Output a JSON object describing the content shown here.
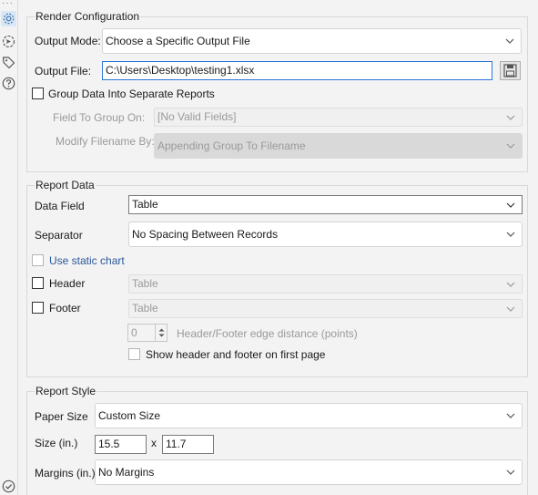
{
  "render": {
    "title": "Render Configuration",
    "output_mode_label": "Output Mode:",
    "output_mode_value": "Choose a Specific Output File",
    "output_file_label": "Output File:",
    "output_file_value": "C:\\Users\\Desktop\\testing1.xlsx",
    "group_data_label": "Group Data Into Separate Reports",
    "field_to_group_label": "Field To Group On:",
    "field_to_group_value": "[No Valid Fields]",
    "modify_filename_label": "Modify Filename By:",
    "modify_filename_value": "Appending Group To Filename"
  },
  "report_data": {
    "title": "Report Data",
    "data_field_label": "Data Field",
    "data_field_value": "Table",
    "separator_label": "Separator",
    "separator_value": "No Spacing Between Records",
    "static_chart_label": "Use static chart",
    "header_label": "Header",
    "header_value": "Table",
    "footer_label": "Footer",
    "footer_value": "Table",
    "edge_distance_value": "0",
    "edge_distance_label": "Header/Footer edge distance (points)",
    "show_first_page_label": "Show header and footer on first page"
  },
  "report_style": {
    "title": "Report Style",
    "paper_size_label": "Paper Size",
    "paper_size_value": "Custom Size",
    "size_label": "Size (in.)",
    "size_width": "15.5",
    "size_x": "x",
    "size_height": "11.7",
    "margins_label": "Margins (in.)",
    "margins_value": "No Margins"
  },
  "rail": {
    "dots": "···",
    "icons": [
      "gear-icon",
      "navigate-icon",
      "tag-icon",
      "help-icon",
      "check-icon"
    ]
  }
}
